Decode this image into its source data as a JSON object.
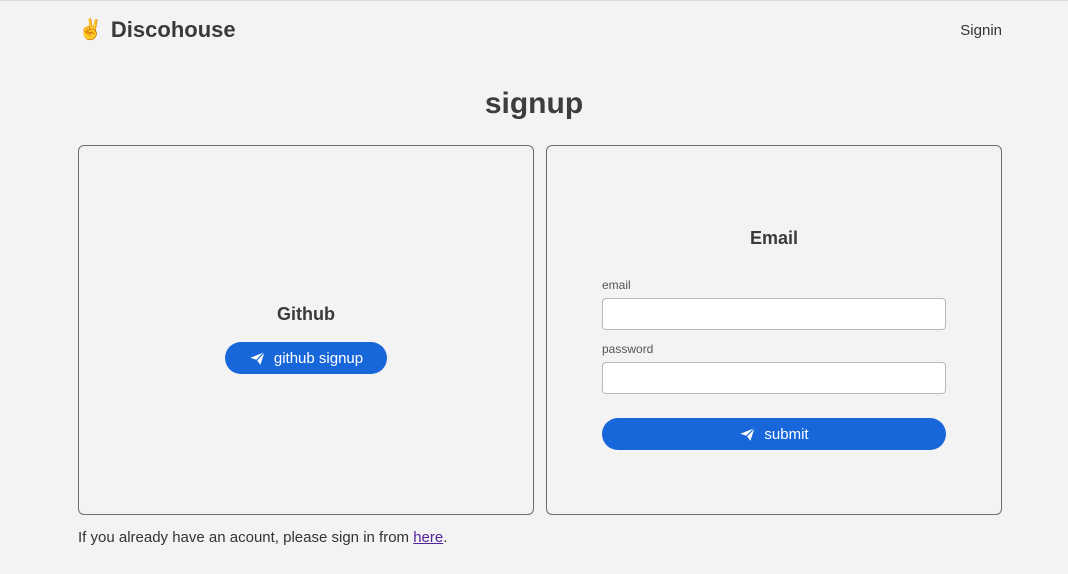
{
  "header": {
    "brand_emoji": "✌️",
    "brand_name": "Discohouse",
    "signin_label": "Signin"
  },
  "page": {
    "title": "signup"
  },
  "github_panel": {
    "heading": "Github",
    "button_label": "github signup",
    "button_icon": "paper-plane-icon"
  },
  "email_panel": {
    "heading": "Email",
    "email_label": "email",
    "email_value": "",
    "password_label": "password",
    "password_value": "",
    "submit_label": "submit",
    "submit_icon": "paper-plane-icon"
  },
  "footer": {
    "text_before": "If you already have an acount, please sign in from ",
    "link_text": "here",
    "text_after": "."
  },
  "colors": {
    "accent": "#1767db",
    "background": "#f3f3f3",
    "link_visited": "#55249c"
  }
}
